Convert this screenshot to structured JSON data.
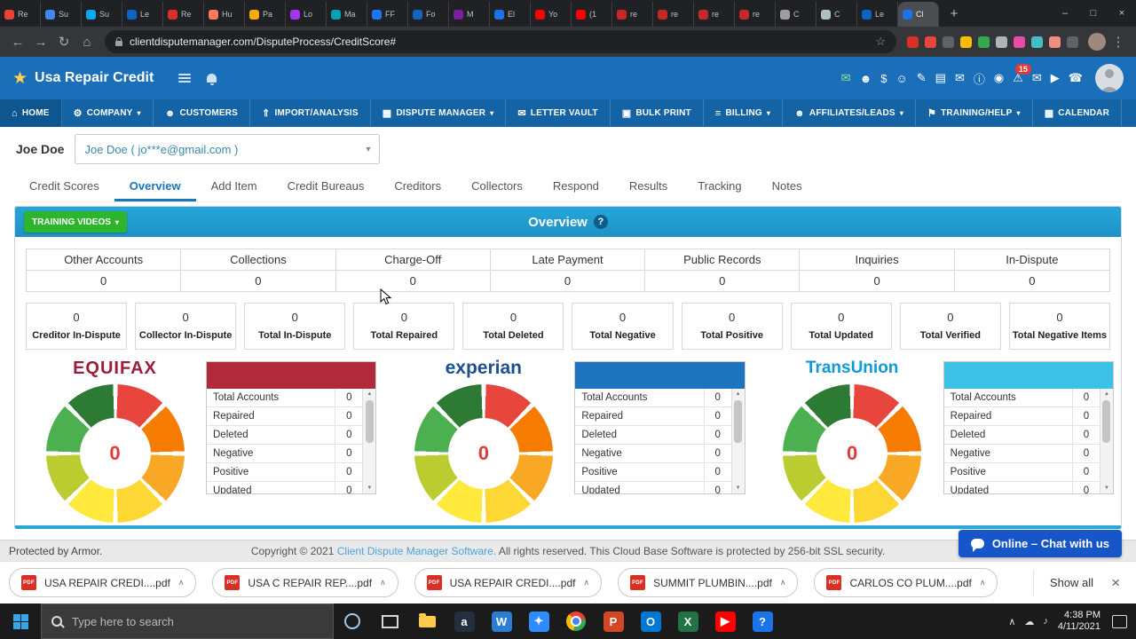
{
  "glyphs": {
    "back": "←",
    "forward": "→",
    "reload": "↻",
    "home": "⌂",
    "star": "☆",
    "menu": "⋮",
    "caret_down": "▾",
    "chevron_up": "∧",
    "tri_up": "▲",
    "tri_down": "▼",
    "brand_star": "★"
  },
  "colors": {
    "header_blue": "#1b6fb8",
    "nav_blue": "#1463a5",
    "panel_teal": "#29a8d8",
    "training_green": "#2db52d",
    "chat_blue": "#1656c9"
  },
  "browser": {
    "tabs": [
      {
        "t": "Re",
        "c": "#ea4335",
        "cls": ""
      },
      {
        "t": "Su",
        "c": "#4285f4",
        "cls": ""
      },
      {
        "t": "Su",
        "c": "#03a9f4",
        "cls": ""
      },
      {
        "t": "Le",
        "c": "#0a66c2",
        "cls": ""
      },
      {
        "t": "Re",
        "c": "#d93025",
        "cls": ""
      },
      {
        "t": "Hu",
        "c": "#ff7a59",
        "cls": ""
      },
      {
        "t": "Pa",
        "c": "#f9ab00",
        "cls": ""
      },
      {
        "t": "Lo",
        "c": "#a435f0",
        "cls": ""
      },
      {
        "t": "Ma",
        "c": "#00a2b3",
        "cls": ""
      },
      {
        "t": "FF",
        "c": "#1877f2",
        "cls": ""
      },
      {
        "t": "Fo",
        "c": "#1565c0",
        "cls": ""
      },
      {
        "t": "M",
        "c": "#7b1fa2",
        "cls": ""
      },
      {
        "t": "El",
        "c": "#1a73e8",
        "cls": ""
      },
      {
        "t": "Yo",
        "c": "#ff0000",
        "cls": ""
      },
      {
        "t": "(1",
        "c": "#ff0000",
        "cls": ""
      },
      {
        "t": "re",
        "c": "#c62828",
        "cls": ""
      },
      {
        "t": "re",
        "c": "#c62828",
        "cls": ""
      },
      {
        "t": "re",
        "c": "#c62828",
        "cls": ""
      },
      {
        "t": "re",
        "c": "#c62828",
        "cls": ""
      },
      {
        "t": "C",
        "c": "#9e9e9e",
        "cls": ""
      },
      {
        "t": "C",
        "c": "#b0bec5",
        "cls": ""
      },
      {
        "t": "Le",
        "c": "#0a66c2",
        "cls": ""
      },
      {
        "t": "Cl",
        "c": "#1a73e8",
        "cls": "active"
      }
    ],
    "new_tab_button": "+",
    "url": "clientdisputemanager.com/DisputeProcess/CreditScore#",
    "extensions": [
      "#d93025",
      "#e8453c",
      "#5f6368",
      "#fbbc04",
      "#34a853",
      "#b0b3b8",
      "#ea4aaa",
      "#46bdc6",
      "#f28b82",
      "#5f6368"
    ],
    "window_controls": {
      "min": "–",
      "max": "□",
      "close": "×"
    }
  },
  "header": {
    "brand": "Usa Repair Credit",
    "icons": [
      {
        "g": "✉",
        "c": "#90ee90",
        "n": "mail-icon",
        "b": ""
      },
      {
        "g": "☻",
        "c": "#ffffff",
        "n": "users-icon",
        "b": ""
      },
      {
        "g": "$",
        "c": "#ffffff",
        "n": "billing-icon",
        "b": ""
      },
      {
        "g": "☺",
        "c": "#ffffff",
        "n": "user-icon",
        "b": ""
      },
      {
        "g": "✎",
        "c": "#ffffff",
        "n": "edit-icon",
        "b": ""
      },
      {
        "g": "▤",
        "c": "#ffffff",
        "n": "documents-icon",
        "b": ""
      },
      {
        "g": "✉",
        "c": "#ffffff",
        "n": "message-icon",
        "b": ""
      },
      {
        "g": "ⓘ",
        "c": "#ffffff",
        "n": "info-icon",
        "b": ""
      },
      {
        "g": "◉",
        "c": "#ffffff",
        "n": "globe-icon",
        "b": ""
      },
      {
        "g": "⚠",
        "c": "#ffffff",
        "n": "alerts-icon",
        "b": "15"
      },
      {
        "g": "✉",
        "c": "#ffffff",
        "n": "mail2-icon",
        "b": ""
      },
      {
        "g": "▶",
        "c": "#ffffff",
        "n": "video-icon",
        "b": ""
      },
      {
        "g": "☎",
        "c": "#ffffff",
        "n": "phone-icon",
        "b": ""
      }
    ]
  },
  "nav": {
    "items": [
      {
        "g": "⌂",
        "t": "HOME",
        "cr": "",
        "dn": "nav-item-home"
      },
      {
        "g": "⚙",
        "t": "COMPANY",
        "cr": "▾",
        "dn": "nav-item-company"
      },
      {
        "g": "☻",
        "t": "CUSTOMERS",
        "cr": "",
        "dn": "nav-item-customers"
      },
      {
        "g": "⇑",
        "t": "IMPORT/ANALYSIS",
        "cr": "",
        "dn": "nav-item-import-analysis"
      },
      {
        "g": "▩",
        "t": "DISPUTE MANAGER",
        "cr": "▾",
        "dn": "nav-item-dispute-manager"
      },
      {
        "g": "✉",
        "t": "LETTER VAULT",
        "cr": "",
        "dn": "nav-item-letter-vault"
      },
      {
        "g": "▣",
        "t": "BULK PRINT",
        "cr": "",
        "dn": "nav-item-bulk-print"
      },
      {
        "g": "≡",
        "t": "BILLING",
        "cr": "▾",
        "dn": "nav-item-billing"
      },
      {
        "g": "☻",
        "t": "AFFILIATES/LEADS",
        "cr": "▾",
        "dn": "nav-item-affiliates-leads"
      },
      {
        "g": "⚑",
        "t": "TRAINING/HELP",
        "cr": "▾",
        "dn": "nav-item-training-help"
      },
      {
        "g": "▦",
        "t": "CALENDAR",
        "cr": "",
        "dn": "nav-item-calendar"
      }
    ]
  },
  "client": {
    "label": "Joe Doe",
    "selected": "Joe Doe ( jo***e@gmail.com )"
  },
  "page_tabs": {
    "items": [
      {
        "t": "Credit Scores",
        "cls": "",
        "dn": "tab-credit-scores"
      },
      {
        "t": "Overview",
        "cls": "active",
        "dn": "tab-overview"
      },
      {
        "t": "Add Item",
        "cls": "",
        "dn": "tab-add-item"
      },
      {
        "t": "Credit Bureaus",
        "cls": "",
        "dn": "tab-credit-bureaus"
      },
      {
        "t": "Creditors",
        "cls": "",
        "dn": "tab-creditors"
      },
      {
        "t": "Collectors",
        "cls": "",
        "dn": "tab-collectors"
      },
      {
        "t": "Respond",
        "cls": "",
        "dn": "tab-respond"
      },
      {
        "t": "Results",
        "cls": "",
        "dn": "tab-results"
      },
      {
        "t": "Tracking",
        "cls": "",
        "dn": "tab-tracking"
      },
      {
        "t": "Notes",
        "cls": "",
        "dn": "tab-notes"
      }
    ]
  },
  "panel": {
    "training_button": "TRAINING VIDEOS",
    "title": "Overview",
    "help_icon": "?"
  },
  "summary": {
    "columns": [
      "Other Accounts",
      "Collections",
      "Charge-Off",
      "Late Payment",
      "Public Records",
      "Inquiries",
      "In-Dispute"
    ],
    "values": [
      "0",
      "0",
      "0",
      "0",
      "0",
      "0",
      "0"
    ]
  },
  "stats": [
    {
      "v": "0",
      "t": "Creditor In-Dispute"
    },
    {
      "v": "0",
      "t": "Collector In-Dispute"
    },
    {
      "v": "0",
      "t": "Total In-Dispute"
    },
    {
      "v": "0",
      "t": "Total Repaired"
    },
    {
      "v": "0",
      "t": "Total Deleted"
    },
    {
      "v": "0",
      "t": "Total Negative"
    },
    {
      "v": "0",
      "t": "Total Positive"
    },
    {
      "v": "0",
      "t": "Total Updated"
    },
    {
      "v": "0",
      "t": "Total Verified"
    },
    {
      "v": "0",
      "t": "Total Negative Items"
    }
  ],
  "bureaus": [
    {
      "name": "EQUIFAX",
      "logo_color": "#9e1b3b",
      "header_color": "#b02a3c",
      "center_value": "0",
      "rows": [
        {
          "t": "Total Accounts",
          "v": "0"
        },
        {
          "t": "Repaired",
          "v": "0"
        },
        {
          "t": "Deleted",
          "v": "0"
        },
        {
          "t": "Negative",
          "v": "0"
        },
        {
          "t": "Positive",
          "v": "0"
        },
        {
          "t": "Updated",
          "v": "0"
        }
      ]
    },
    {
      "name": "experian",
      "logo_color": "#1d4f91",
      "header_color": "#1e73be",
      "center_value": "0",
      "rows": [
        {
          "t": "Total Accounts",
          "v": "0"
        },
        {
          "t": "Repaired",
          "v": "0"
        },
        {
          "t": "Deleted",
          "v": "0"
        },
        {
          "t": "Negative",
          "v": "0"
        },
        {
          "t": "Positive",
          "v": "0"
        },
        {
          "t": "Updated",
          "v": "0"
        }
      ]
    },
    {
      "name": "TransUnion",
      "logo_color": "#0e9ad6",
      "header_color": "#3ec1e6",
      "center_value": "0",
      "rows": [
        {
          "t": "Total Accounts",
          "v": "0"
        },
        {
          "t": "Repaired",
          "v": "0"
        },
        {
          "t": "Deleted",
          "v": "0"
        },
        {
          "t": "Negative",
          "v": "0"
        },
        {
          "t": "Positive",
          "v": "0"
        },
        {
          "t": "Updated",
          "v": "0"
        }
      ]
    }
  ],
  "footer": {
    "left": "Protected by Armor.",
    "copyright": "Copyright © 2021 ",
    "link": "Client Dispute Manager Software.",
    "rest": " All rights reserved. This Cloud Base Software is protected by 256-bit SSL security."
  },
  "chat": {
    "label": "Online – Chat with us"
  },
  "downloads": {
    "pdf_badge": "PDF",
    "files": [
      {
        "n": "USA REPAIR CREDI....pdf"
      },
      {
        "n": "USA C REPAIR REP....pdf"
      },
      {
        "n": "USA REPAIR CREDI....pdf"
      },
      {
        "n": "SUMMIT PLUMBIN....pdf"
      },
      {
        "n": "CARLOS CO PLUM....pdf"
      }
    ],
    "show_all": "Show all"
  },
  "taskbar": {
    "search_placeholder": "Type here to search",
    "apps_a": [
      {
        "g": "a",
        "c": "#232f3e",
        "dn": "amazon-icon"
      },
      {
        "g": "W",
        "c": "#2b7cd3",
        "dn": "word-icon"
      },
      {
        "g": "✦",
        "c": "#2d8cff",
        "dn": "zoom-icon"
      }
    ],
    "apps_b": [
      {
        "g": "P",
        "c": "#d24726",
        "dn": "powerpoint-icon"
      },
      {
        "g": "O",
        "c": "#0078d4",
        "dn": "outlook-icon"
      },
      {
        "g": "X",
        "c": "#217346",
        "dn": "excel-icon"
      },
      {
        "g": "▶",
        "c": "#ff0000",
        "dn": "youtube-icon"
      },
      {
        "g": "?",
        "c": "#1a73e8",
        "dn": "help-icon"
      }
    ],
    "tray": [
      "∧",
      "☁",
      "♪"
    ],
    "time": "4:38 PM",
    "date": "4/11/2021"
  }
}
